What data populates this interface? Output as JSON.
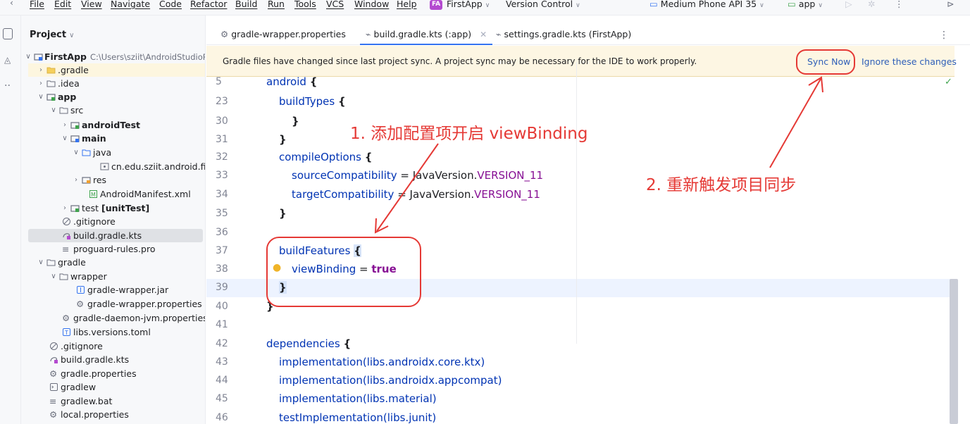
{
  "menubar": {
    "items": [
      "File",
      "Edit",
      "View",
      "Navigate",
      "Code",
      "Refactor",
      "Build",
      "Run",
      "Tools",
      "VCS",
      "Window",
      "Help"
    ],
    "project_badge": "FA",
    "project_name": "FirstApp",
    "version_control": "Version Control",
    "device": "Medium Phone API 35",
    "run_config": "app"
  },
  "project_panel": {
    "title": "Project",
    "rows": [
      {
        "label": "FirstApp",
        "path": "C:\\Users\\sziit\\AndroidStudioPro"
      },
      {
        "label": ".gradle"
      },
      {
        "label": ".idea"
      },
      {
        "label": "app"
      },
      {
        "label": "src"
      },
      {
        "label": "androidTest"
      },
      {
        "label": "main"
      },
      {
        "label": "java"
      },
      {
        "label": "cn.edu.sziit.android.firstap"
      },
      {
        "label": "res"
      },
      {
        "label": "AndroidManifest.xml"
      },
      {
        "label": "test",
        "suffix": "[unitTest]"
      },
      {
        "label": ".gitignore"
      },
      {
        "label": "build.gradle.kts"
      },
      {
        "label": "proguard-rules.pro"
      },
      {
        "label": "gradle"
      },
      {
        "label": "wrapper"
      },
      {
        "label": "gradle-wrapper.jar"
      },
      {
        "label": "gradle-wrapper.properties"
      },
      {
        "label": "gradle-daemon-jvm.properties"
      },
      {
        "label": "libs.versions.toml"
      },
      {
        "label": ".gitignore"
      },
      {
        "label": "build.gradle.kts"
      },
      {
        "label": "gradle.properties"
      },
      {
        "label": "gradlew"
      },
      {
        "label": "gradlew.bat"
      },
      {
        "label": "local.properties"
      }
    ]
  },
  "tabs": [
    {
      "label": "gradle-wrapper.properties"
    },
    {
      "label": "build.gradle.kts (:app)"
    },
    {
      "label": "settings.gradle.kts (FirstApp)"
    }
  ],
  "banner": {
    "text": "Gradle files have changed since last project sync. A project sync may be necessary for the IDE to work properly.",
    "sync_now": "Sync Now",
    "ignore": "Ignore these changes"
  },
  "code": {
    "line_numbers": [
      "5",
      "23",
      "30",
      "31",
      "32",
      "33",
      "34",
      "35",
      "36",
      "37",
      "38",
      "39",
      "40",
      "41",
      "42",
      "43",
      "44",
      "45",
      "46"
    ],
    "lines": {
      "l5_fn": "android",
      "l5_brace": "{",
      "l23_fn": "buildTypes",
      "l23_brace": "{",
      "l30": "}",
      "l31": "}",
      "l32_fn": "compileOptions",
      "l32_brace": "{",
      "l33_a": "sourceCompatibility",
      "l33_b": " = ",
      "l33_c": "JavaVersion",
      "l33_d": ".",
      "l33_e": "VERSION_11",
      "l34_a": "targetCompatibility",
      "l34_b": " = ",
      "l34_c": "JavaVersion",
      "l34_d": ".",
      "l34_e": "VERSION_11",
      "l35": "}",
      "l37_fn": "buildFeatures",
      "l37_brace": "{",
      "l38_a": "viewBinding",
      "l38_b": " = ",
      "l38_c": "true",
      "l39": "}",
      "l40": "}",
      "l42_fn": "dependencies",
      "l42_brace": "{",
      "l43": "implementation(libs.androidx.core.ktx)",
      "l44": "implementation(libs.androidx.appcompat)",
      "l45": "implementation(libs.material)",
      "l46": "testImplementation(libs.junit)"
    }
  },
  "annotations": {
    "step1": "1. 添加配置项开启 viewBinding",
    "step2": "2. 重新触发项目同步"
  },
  "colors": {
    "annotation_red": "#e53935",
    "link_blue": "#2e5eb8",
    "banner_bg": "#fdf6e3",
    "selection": "#dfe1e5"
  }
}
